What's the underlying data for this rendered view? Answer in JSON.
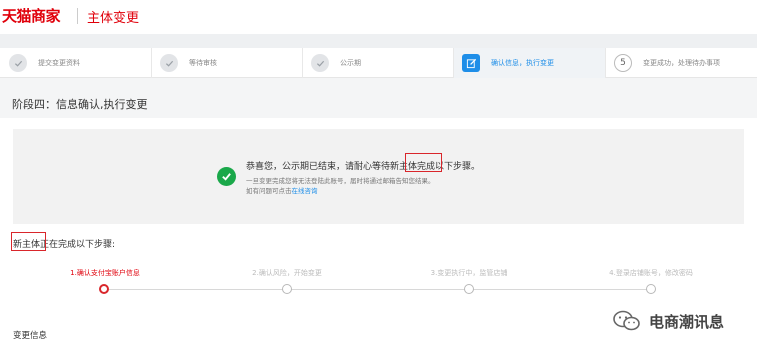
{
  "header": {
    "logo": "天猫商家",
    "title": "主体变更"
  },
  "stepper": {
    "steps": [
      {
        "label": "提交变更资料",
        "state": "done"
      },
      {
        "label": "等待审核",
        "state": "done"
      },
      {
        "label": "公示期",
        "state": "done"
      },
      {
        "label": "确认信息，执行变更",
        "state": "active"
      },
      {
        "label": "变更成功，处理待办事项",
        "state": "todo",
        "number": "5"
      }
    ]
  },
  "phase_title": "阶段四：信息确认,执行变更",
  "notice": {
    "main": "恭喜您，公示期已结束，请耐心等待新主体完成以下步骤。",
    "sub1": "一旦变更完成您将无法登陆此账号，届时将通过邮箱告知您结果。",
    "sub2_prefix": "如有问题可点击",
    "sub2_link": "在线咨询"
  },
  "progress": {
    "title": "新主体正在完成以下步骤:",
    "steps": [
      {
        "label": "1.确认支付宝账户信息",
        "current": true
      },
      {
        "label": "2.确认风险，开始变更",
        "current": false
      },
      {
        "label": "3.变更执行中，监管店铺",
        "current": false
      },
      {
        "label": "4.登录店铺账号，修改密码",
        "current": false
      }
    ]
  },
  "change_info": "变更信息",
  "watermark": "电商潮讯息",
  "colors": {
    "brand_red": "#e0000b",
    "active_blue": "#1e8ee8",
    "success_green": "#1aa84a",
    "highlight_box": "#d9262b"
  }
}
